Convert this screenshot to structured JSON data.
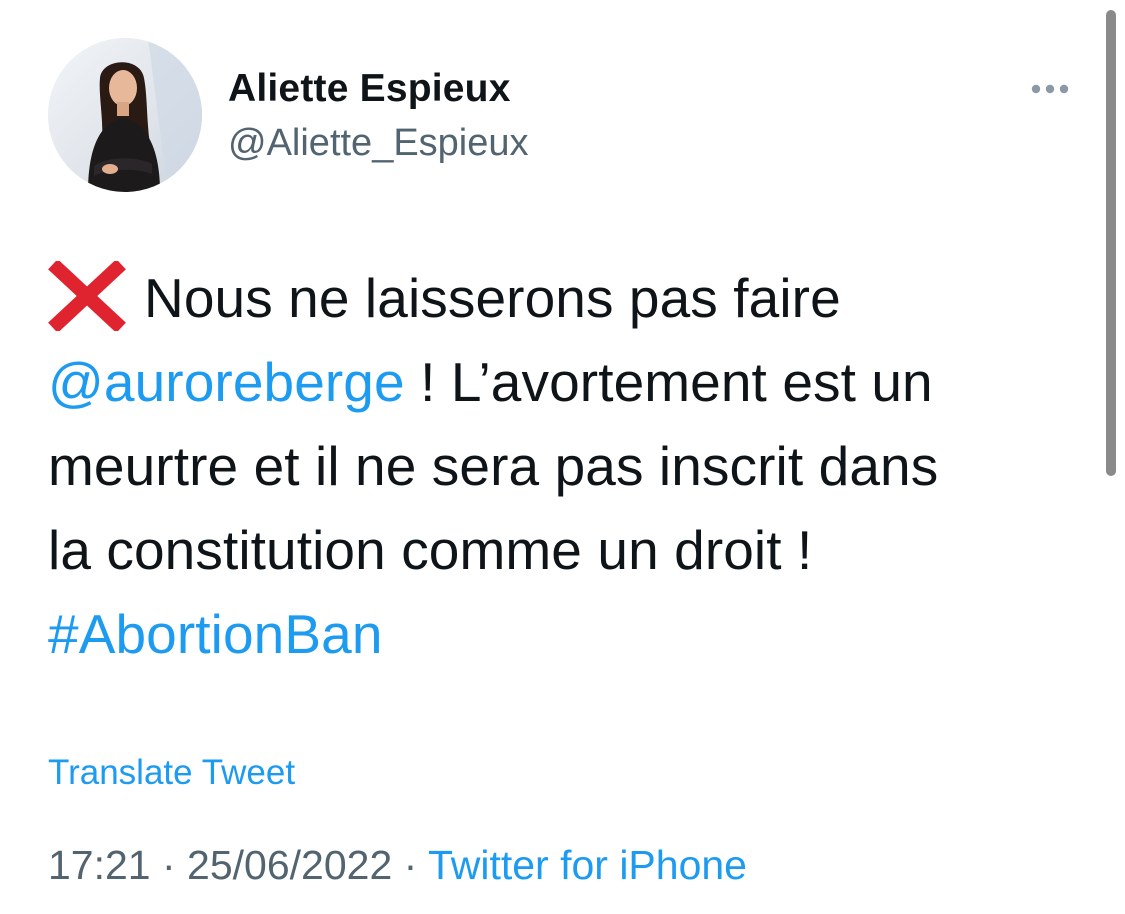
{
  "author": {
    "display_name": "Aliette Espieux",
    "handle": "@Aliette_Espieux"
  },
  "tweet": {
    "lead_emoji": "cross-mark-icon",
    "line1_text": "Nous ne laisserons pas faire",
    "mention": "@auroreberge",
    "line2_text": " ! L’avortement est un",
    "line3_text": "meurtre et il ne sera pas inscrit dans",
    "line4_text": "la constitution comme un droit !",
    "hashtag": "#AbortionBan"
  },
  "translate_label": "Translate Tweet",
  "meta": {
    "time": "17:21",
    "separator": " · ",
    "date": "25/06/2022",
    "source": "Twitter for iPhone"
  },
  "colors": {
    "link": "#1d9bf0",
    "text": "#0f1419",
    "secondary": "#536471",
    "cross": "#e0242f"
  }
}
